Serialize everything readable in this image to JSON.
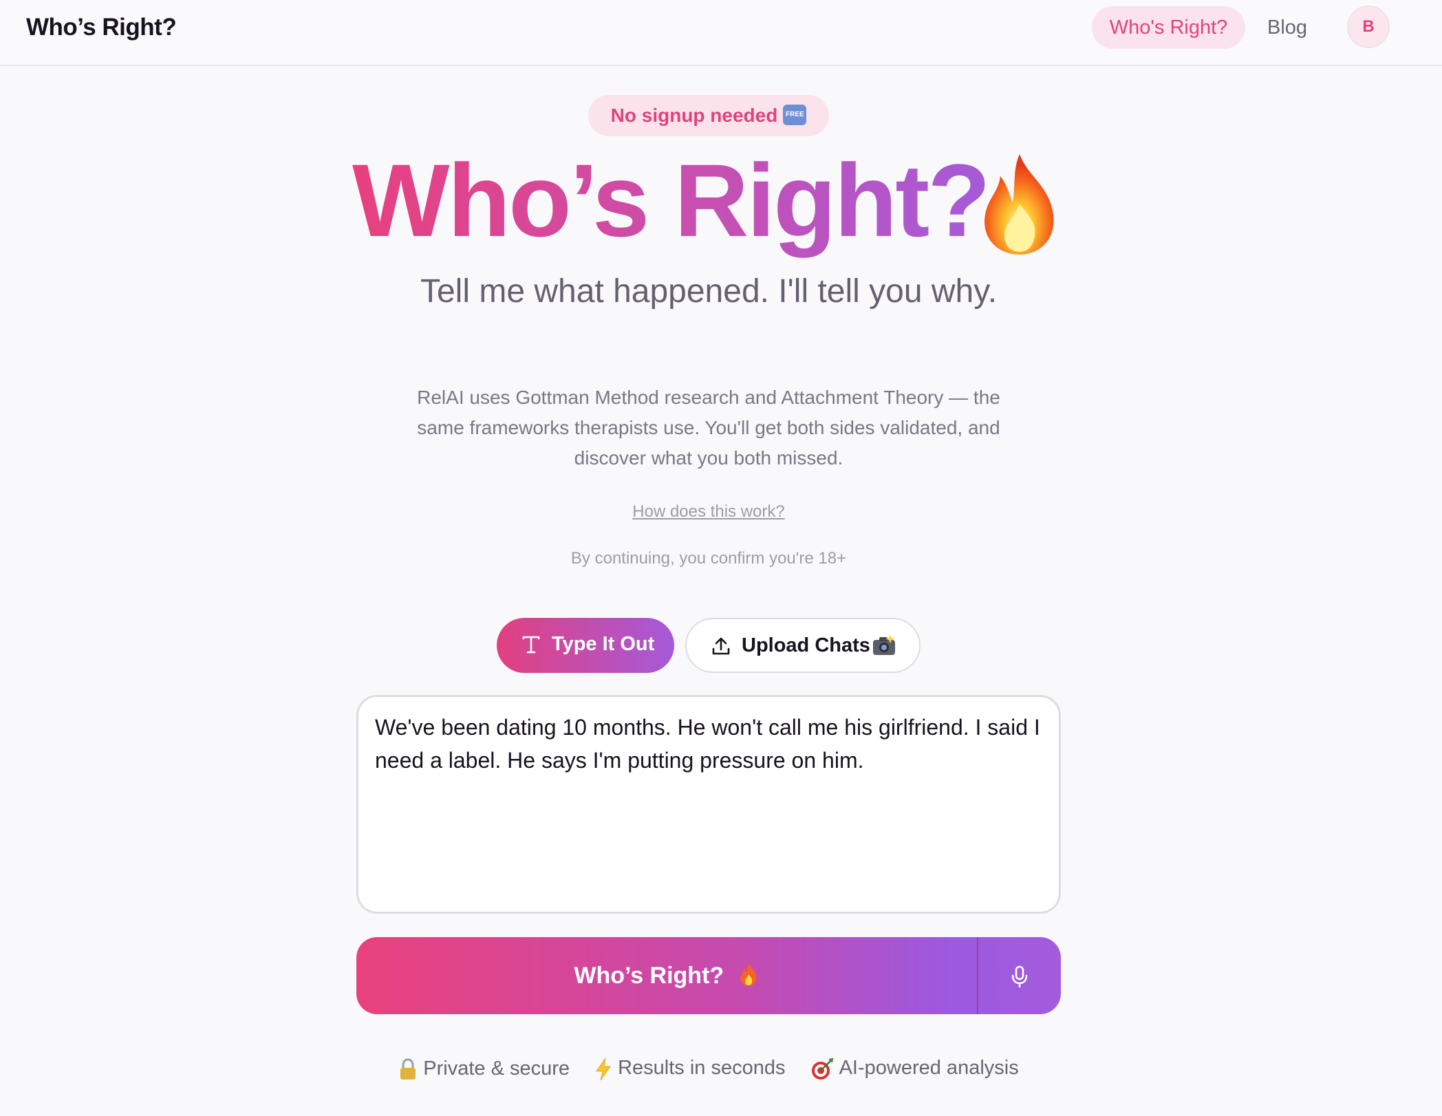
{
  "header": {
    "brand": "Who’s Right?",
    "nav_active": "Who's Right?",
    "nav_blog": "Blog",
    "avatar_initial": "B"
  },
  "badge": {
    "text": "No signup needed",
    "free_label": "FREE"
  },
  "hero": {
    "title": "Who’s Right?",
    "subtitle": "Tell me what happened. I'll tell you why.",
    "description": "RelAI uses Gottman Method research and Attachment Theory — the same frameworks therapists use. You'll get both sides validated, and discover what you both missed."
  },
  "links": {
    "how": "How does this work?",
    "confirm": "By continuing, you confirm you're 18+"
  },
  "tabs": [
    {
      "label": "Type It Out",
      "icon": "text-icon",
      "active": true
    },
    {
      "label": "Upload Chats",
      "icon": "upload-icon",
      "active": false
    }
  ],
  "input": {
    "value": "We've been dating 10 months. He won't call me his girlfriend. I said I need a label. He says I'm putting pressure on him."
  },
  "submit": {
    "label": "Who’s Right?",
    "mic_icon": "microphone-icon"
  },
  "features": [
    {
      "icon": "lock-icon",
      "label": "Private & secure"
    },
    {
      "icon": "lightning-icon",
      "label": "Results in seconds"
    },
    {
      "icon": "target-icon",
      "label": "AI-powered analysis"
    }
  ],
  "colors": {
    "accent_pink": "#e5427b",
    "accent_purple": "#a55ad9",
    "background": "#f9f8fb"
  }
}
